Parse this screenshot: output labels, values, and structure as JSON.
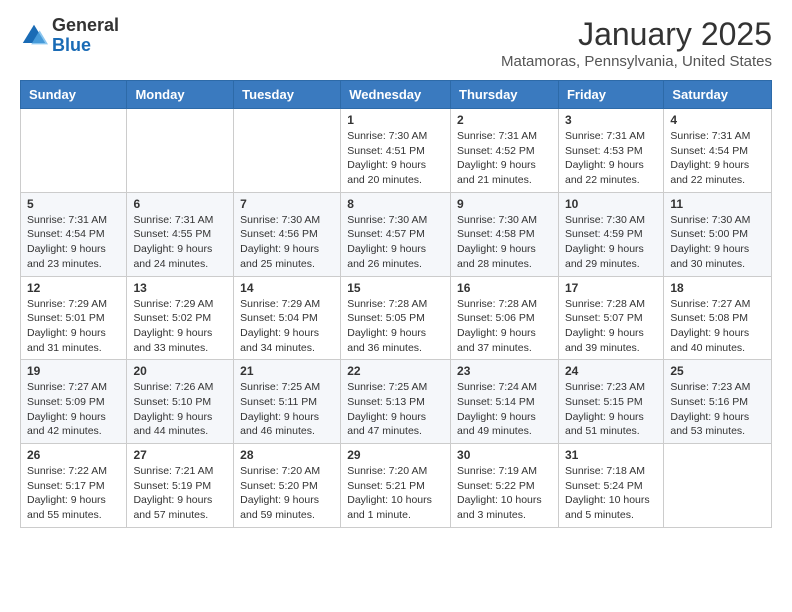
{
  "header": {
    "logo_general": "General",
    "logo_blue": "Blue",
    "main_title": "January 2025",
    "subtitle": "Matamoras, Pennsylvania, United States"
  },
  "days_of_week": [
    "Sunday",
    "Monday",
    "Tuesday",
    "Wednesday",
    "Thursday",
    "Friday",
    "Saturday"
  ],
  "weeks": [
    [
      {
        "day": "",
        "info": ""
      },
      {
        "day": "",
        "info": ""
      },
      {
        "day": "",
        "info": ""
      },
      {
        "day": "1",
        "info": "Sunrise: 7:30 AM\nSunset: 4:51 PM\nDaylight: 9 hours\nand 20 minutes."
      },
      {
        "day": "2",
        "info": "Sunrise: 7:31 AM\nSunset: 4:52 PM\nDaylight: 9 hours\nand 21 minutes."
      },
      {
        "day": "3",
        "info": "Sunrise: 7:31 AM\nSunset: 4:53 PM\nDaylight: 9 hours\nand 22 minutes."
      },
      {
        "day": "4",
        "info": "Sunrise: 7:31 AM\nSunset: 4:54 PM\nDaylight: 9 hours\nand 22 minutes."
      }
    ],
    [
      {
        "day": "5",
        "info": "Sunrise: 7:31 AM\nSunset: 4:54 PM\nDaylight: 9 hours\nand 23 minutes."
      },
      {
        "day": "6",
        "info": "Sunrise: 7:31 AM\nSunset: 4:55 PM\nDaylight: 9 hours\nand 24 minutes."
      },
      {
        "day": "7",
        "info": "Sunrise: 7:30 AM\nSunset: 4:56 PM\nDaylight: 9 hours\nand 25 minutes."
      },
      {
        "day": "8",
        "info": "Sunrise: 7:30 AM\nSunset: 4:57 PM\nDaylight: 9 hours\nand 26 minutes."
      },
      {
        "day": "9",
        "info": "Sunrise: 7:30 AM\nSunset: 4:58 PM\nDaylight: 9 hours\nand 28 minutes."
      },
      {
        "day": "10",
        "info": "Sunrise: 7:30 AM\nSunset: 4:59 PM\nDaylight: 9 hours\nand 29 minutes."
      },
      {
        "day": "11",
        "info": "Sunrise: 7:30 AM\nSunset: 5:00 PM\nDaylight: 9 hours\nand 30 minutes."
      }
    ],
    [
      {
        "day": "12",
        "info": "Sunrise: 7:29 AM\nSunset: 5:01 PM\nDaylight: 9 hours\nand 31 minutes."
      },
      {
        "day": "13",
        "info": "Sunrise: 7:29 AM\nSunset: 5:02 PM\nDaylight: 9 hours\nand 33 minutes."
      },
      {
        "day": "14",
        "info": "Sunrise: 7:29 AM\nSunset: 5:04 PM\nDaylight: 9 hours\nand 34 minutes."
      },
      {
        "day": "15",
        "info": "Sunrise: 7:28 AM\nSunset: 5:05 PM\nDaylight: 9 hours\nand 36 minutes."
      },
      {
        "day": "16",
        "info": "Sunrise: 7:28 AM\nSunset: 5:06 PM\nDaylight: 9 hours\nand 37 minutes."
      },
      {
        "day": "17",
        "info": "Sunrise: 7:28 AM\nSunset: 5:07 PM\nDaylight: 9 hours\nand 39 minutes."
      },
      {
        "day": "18",
        "info": "Sunrise: 7:27 AM\nSunset: 5:08 PM\nDaylight: 9 hours\nand 40 minutes."
      }
    ],
    [
      {
        "day": "19",
        "info": "Sunrise: 7:27 AM\nSunset: 5:09 PM\nDaylight: 9 hours\nand 42 minutes."
      },
      {
        "day": "20",
        "info": "Sunrise: 7:26 AM\nSunset: 5:10 PM\nDaylight: 9 hours\nand 44 minutes."
      },
      {
        "day": "21",
        "info": "Sunrise: 7:25 AM\nSunset: 5:11 PM\nDaylight: 9 hours\nand 46 minutes."
      },
      {
        "day": "22",
        "info": "Sunrise: 7:25 AM\nSunset: 5:13 PM\nDaylight: 9 hours\nand 47 minutes."
      },
      {
        "day": "23",
        "info": "Sunrise: 7:24 AM\nSunset: 5:14 PM\nDaylight: 9 hours\nand 49 minutes."
      },
      {
        "day": "24",
        "info": "Sunrise: 7:23 AM\nSunset: 5:15 PM\nDaylight: 9 hours\nand 51 minutes."
      },
      {
        "day": "25",
        "info": "Sunrise: 7:23 AM\nSunset: 5:16 PM\nDaylight: 9 hours\nand 53 minutes."
      }
    ],
    [
      {
        "day": "26",
        "info": "Sunrise: 7:22 AM\nSunset: 5:17 PM\nDaylight: 9 hours\nand 55 minutes."
      },
      {
        "day": "27",
        "info": "Sunrise: 7:21 AM\nSunset: 5:19 PM\nDaylight: 9 hours\nand 57 minutes."
      },
      {
        "day": "28",
        "info": "Sunrise: 7:20 AM\nSunset: 5:20 PM\nDaylight: 9 hours\nand 59 minutes."
      },
      {
        "day": "29",
        "info": "Sunrise: 7:20 AM\nSunset: 5:21 PM\nDaylight: 10 hours\nand 1 minute."
      },
      {
        "day": "30",
        "info": "Sunrise: 7:19 AM\nSunset: 5:22 PM\nDaylight: 10 hours\nand 3 minutes."
      },
      {
        "day": "31",
        "info": "Sunrise: 7:18 AM\nSunset: 5:24 PM\nDaylight: 10 hours\nand 5 minutes."
      },
      {
        "day": "",
        "info": ""
      }
    ]
  ]
}
